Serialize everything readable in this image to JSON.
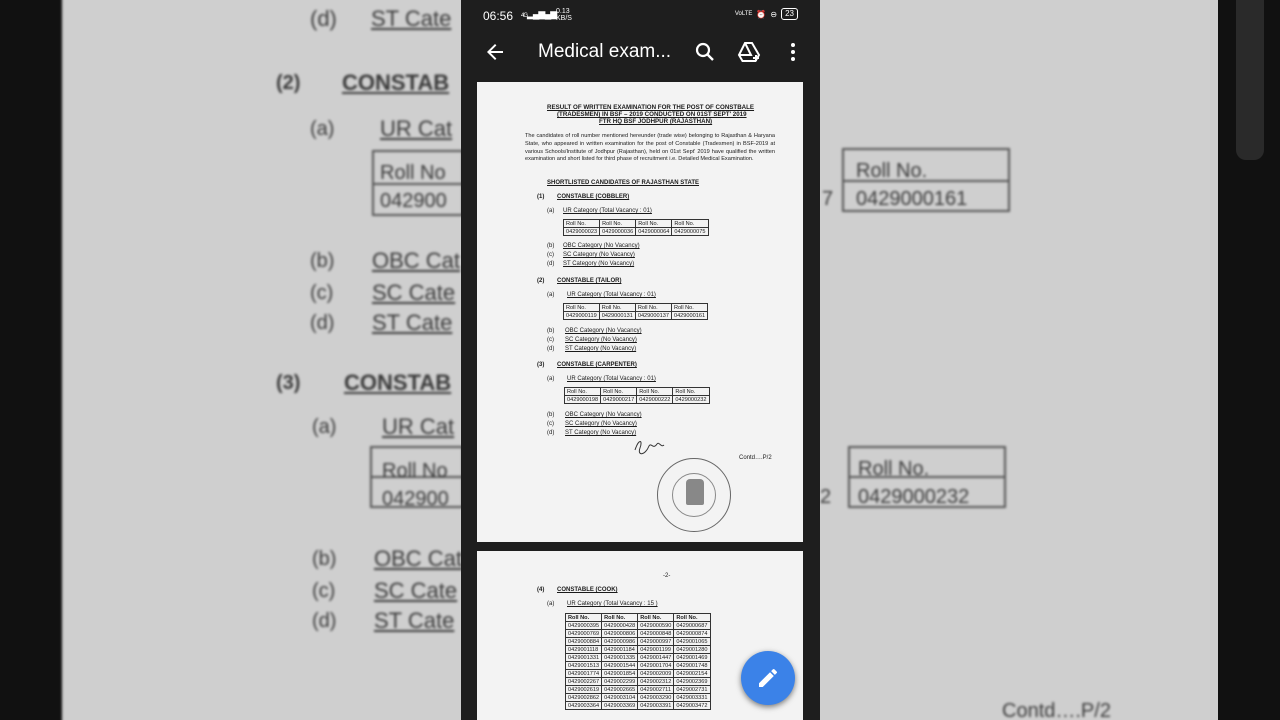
{
  "status_bar": {
    "time": "06:56",
    "network_4g": "4G",
    "data_rate": "0.13",
    "data_rate_unit": "KB/S",
    "network_right": "VoLTE",
    "battery": "23"
  },
  "app_bar": {
    "title": "Medical exam...",
    "icons": [
      "back-arrow-icon",
      "search-icon",
      "drive-add-icon",
      "more-vert-icon"
    ]
  },
  "doc": {
    "heading_line1": "RESULT OF WRITTEN EXAMINATION FOR THE POST OF CONSTBALE",
    "heading_line2": "(TRADESMEN) IN BSF – 2019 CONDUCTED ON 01ST SEPT' 2019",
    "heading_line3": "FTR HQ BSF JODHPUR (RAJASTHAN)",
    "paragraph": "The candidates of roll number mentioned hereunder (trade wise) belonging to Rajasthan & Haryana State, who appeared in written examination for the post of Constable (Tradesmen) in BSF-2019 at various Schools/Institute of Jodhpur (Rajasthan), held on 01st Sept' 2019 have qualified the written examination and short listed for third phase of recruitment i.e. Detailed Medical Examination.",
    "shortlisted_title": "SHORTLISTED CANDIDATES OF RAJASTHAN STATE",
    "roll_header": "Roll No.",
    "sections": [
      {
        "num": "(1)",
        "title": "CONSTABLE (COBBLER)",
        "ur_label": "UR Category (Total Vacancy  :  01)",
        "rolls": [
          "0429000023",
          "0429000036",
          "0429000064",
          "0429000075"
        ]
      },
      {
        "num": "(2)",
        "title": "CONSTABLE (TAILOR)",
        "ur_label": "UR Category (Total Vacancy  :  01)",
        "rolls": [
          "0429000119",
          "0429000131",
          "0429000137",
          "0429000161"
        ]
      },
      {
        "num": "(3)",
        "title": "CONSTABLE (CARPENTER)",
        "ur_label": "UR Category (Total Vacancy  :  01)",
        "rolls": [
          "0429000198",
          "0429000217",
          "0429000222",
          "0429000232"
        ]
      }
    ],
    "sub_a": "(a)",
    "sub_b": "(b)",
    "sub_c": "(c)",
    "sub_d": "(d)",
    "obc": "OBC Category (No Vacancy)",
    "sc": "SC Category (No Vacancy)",
    "st": "ST Category (No Vacancy)",
    "contd": "Contd….P/2",
    "page2_number": "-2-",
    "section4": {
      "num": "(4)",
      "title": "CONSTABLE (COOK)",
      "ur_label": "UR Category (Total Vacancy  :  15 )",
      "rows": [
        [
          "0429000395",
          "0429000428",
          "0429000590",
          "0429000687"
        ],
        [
          "0429000769",
          "0429000806",
          "0429000848",
          "0429000874"
        ],
        [
          "0429000884",
          "0429000986",
          "0429000997",
          "0429001065"
        ],
        [
          "0429001118",
          "0429001184",
          "0429001199",
          "0429001280"
        ],
        [
          "0429001331",
          "0429001335",
          "0429001447",
          "0429001469"
        ],
        [
          "0429001513",
          "0429001544",
          "0429001704",
          "0429001748"
        ],
        [
          "0429001774",
          "0429001854",
          "0429002009",
          "0429002154"
        ],
        [
          "0429002267",
          "0429002299",
          "0429002312",
          "0429002369"
        ],
        [
          "0429002619",
          "0429002665",
          "0429002711",
          "0429002731"
        ],
        [
          "0429002862",
          "0429003104",
          "0429003290",
          "0429003331"
        ],
        [
          "0429003364",
          "0429003369",
          "0429003391",
          "0429003472"
        ]
      ]
    }
  },
  "background": {
    "d_st": "(d)   ST Cate",
    "section2": "(2)",
    "constab": "CONSTAB",
    "a_ur": "(a)",
    "ur_cat": "UR Cat",
    "roll_no_left": "Roll No",
    "roll_left": "042900",
    "roll_no_right": "Roll No.",
    "roll_right_top": "0429000161",
    "roll_right_bottom": "0429000232",
    "frag7": "7",
    "frag2": "2",
    "b_obc": "OBC Cat",
    "c_sc": "SC Cate",
    "d_st2": "ST Cate",
    "section3": "(3)",
    "b": "(b)",
    "c": "(c)",
    "d": "(d)",
    "contd": "Contd….P/2"
  },
  "fab": {
    "icon": "edit-pencil-icon",
    "color": "#3b82e8"
  }
}
